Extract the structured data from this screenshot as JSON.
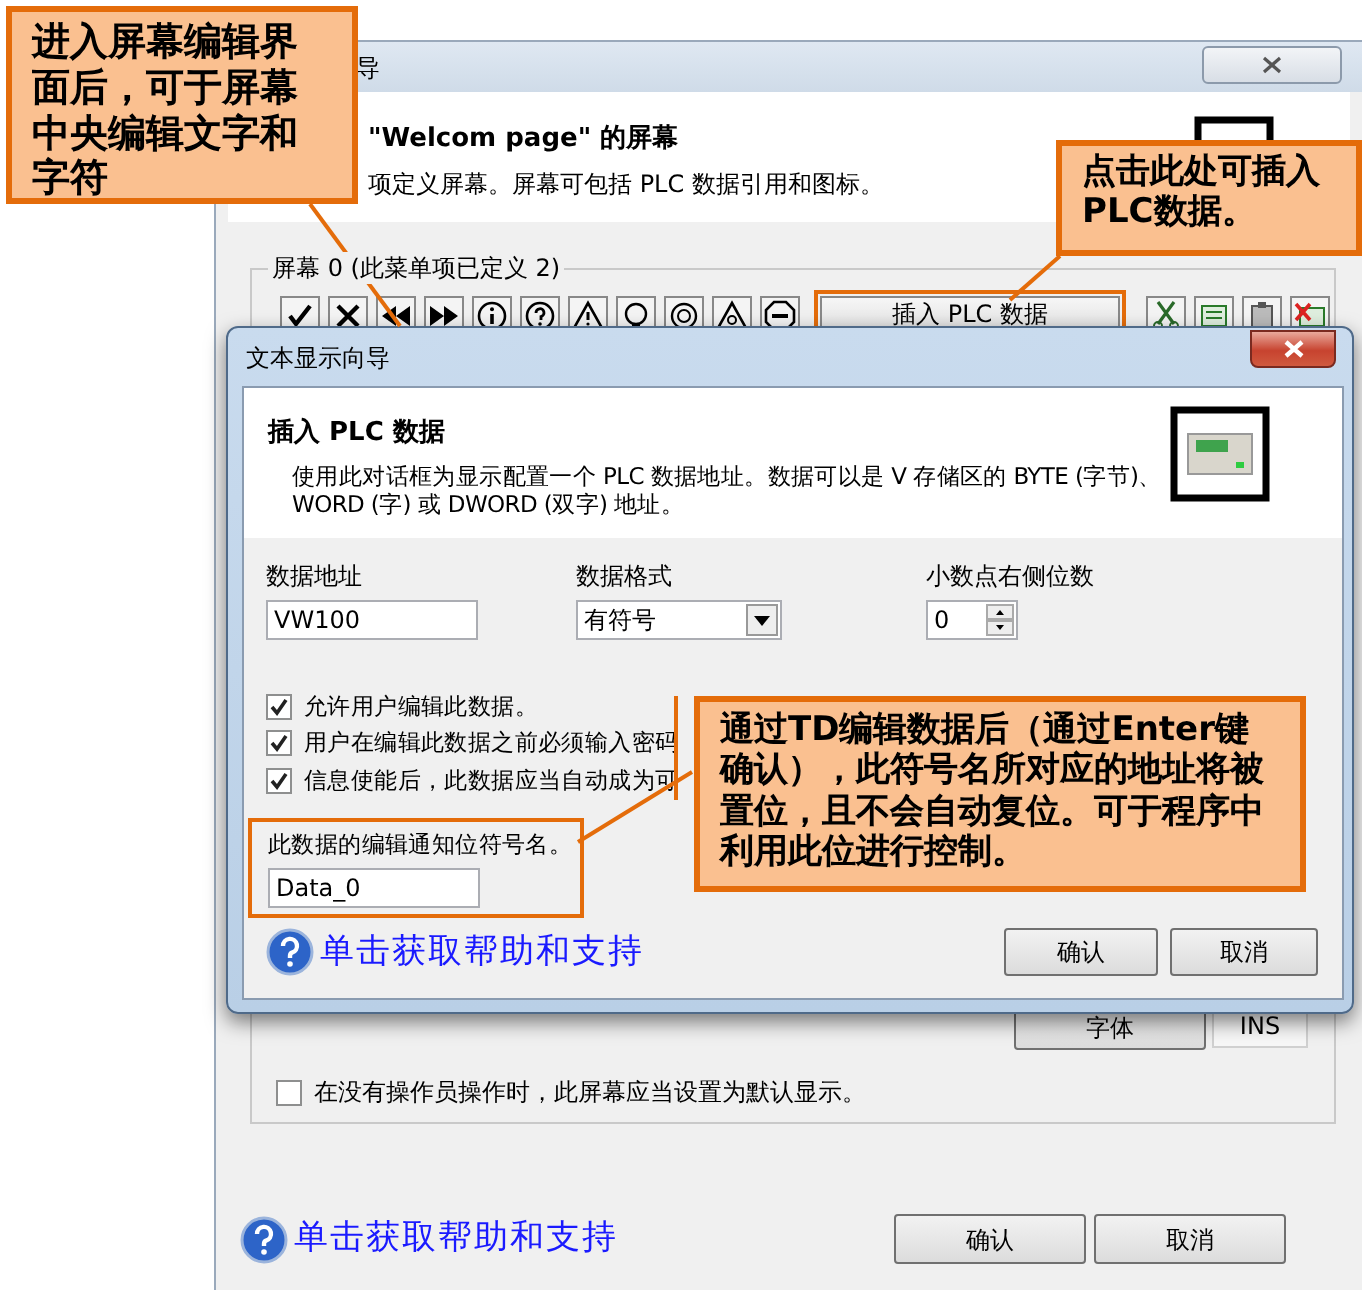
{
  "background_window": {
    "title": "导",
    "heading": "\"Welcom page\" 的屏幕",
    "description": "项定义屏幕。屏幕可包括 PLC 数据引用和图标。",
    "group_label": "屏幕 0 (此菜单项已定义 2)",
    "insert_button": "插入 PLC 数据",
    "font_button": "字体",
    "mode_indicator": "INS",
    "default_display": {
      "label": "在没有操作员操作时，此屏幕应当设置为默认显示。",
      "checked": false
    },
    "help_link": "单击获取帮助和支持",
    "buttons": [
      "确认",
      "取消"
    ]
  },
  "dialog": {
    "title": "文本显示向导",
    "heading": "插入 PLC 数据",
    "description": "使用此对话框为显示配置一个 PLC 数据地址。数据可以是 V 存储区的 BYTE (字节)、WORD (字) 或 DWORD (双字) 地址。",
    "fields": [
      {
        "label": "数据地址",
        "kind": "text",
        "value": "VW100"
      },
      {
        "label": "数据格式",
        "kind": "select",
        "value": "有符号"
      },
      {
        "label": "小数点右侧位数",
        "kind": "spinner",
        "value": "0"
      }
    ],
    "options": [
      {
        "label": "允许用户编辑此数据。",
        "checked": true
      },
      {
        "label": "用户在编辑此数据之前必须输入密码",
        "checked": true
      },
      {
        "label": "信息使能后，此数据应当自动成为可",
        "checked": true
      }
    ],
    "notify_bit": {
      "label": "此数据的编辑通知位符号名。",
      "value": "Data_0"
    },
    "help_link": "单击获取帮助和支持",
    "buttons": [
      "确认",
      "取消"
    ]
  },
  "callouts": [
    {
      "text": "进入屏幕编辑界面后，可于屏幕中央编辑文字和字符"
    },
    {
      "text": "点击此处可插入PLC数据。"
    },
    {
      "text": "通过TD编辑数据后（通过Enter键确认），此符号名所对应的地址将被置位，且不会自动复位。可于程序中利用此位进行控制。"
    }
  ]
}
